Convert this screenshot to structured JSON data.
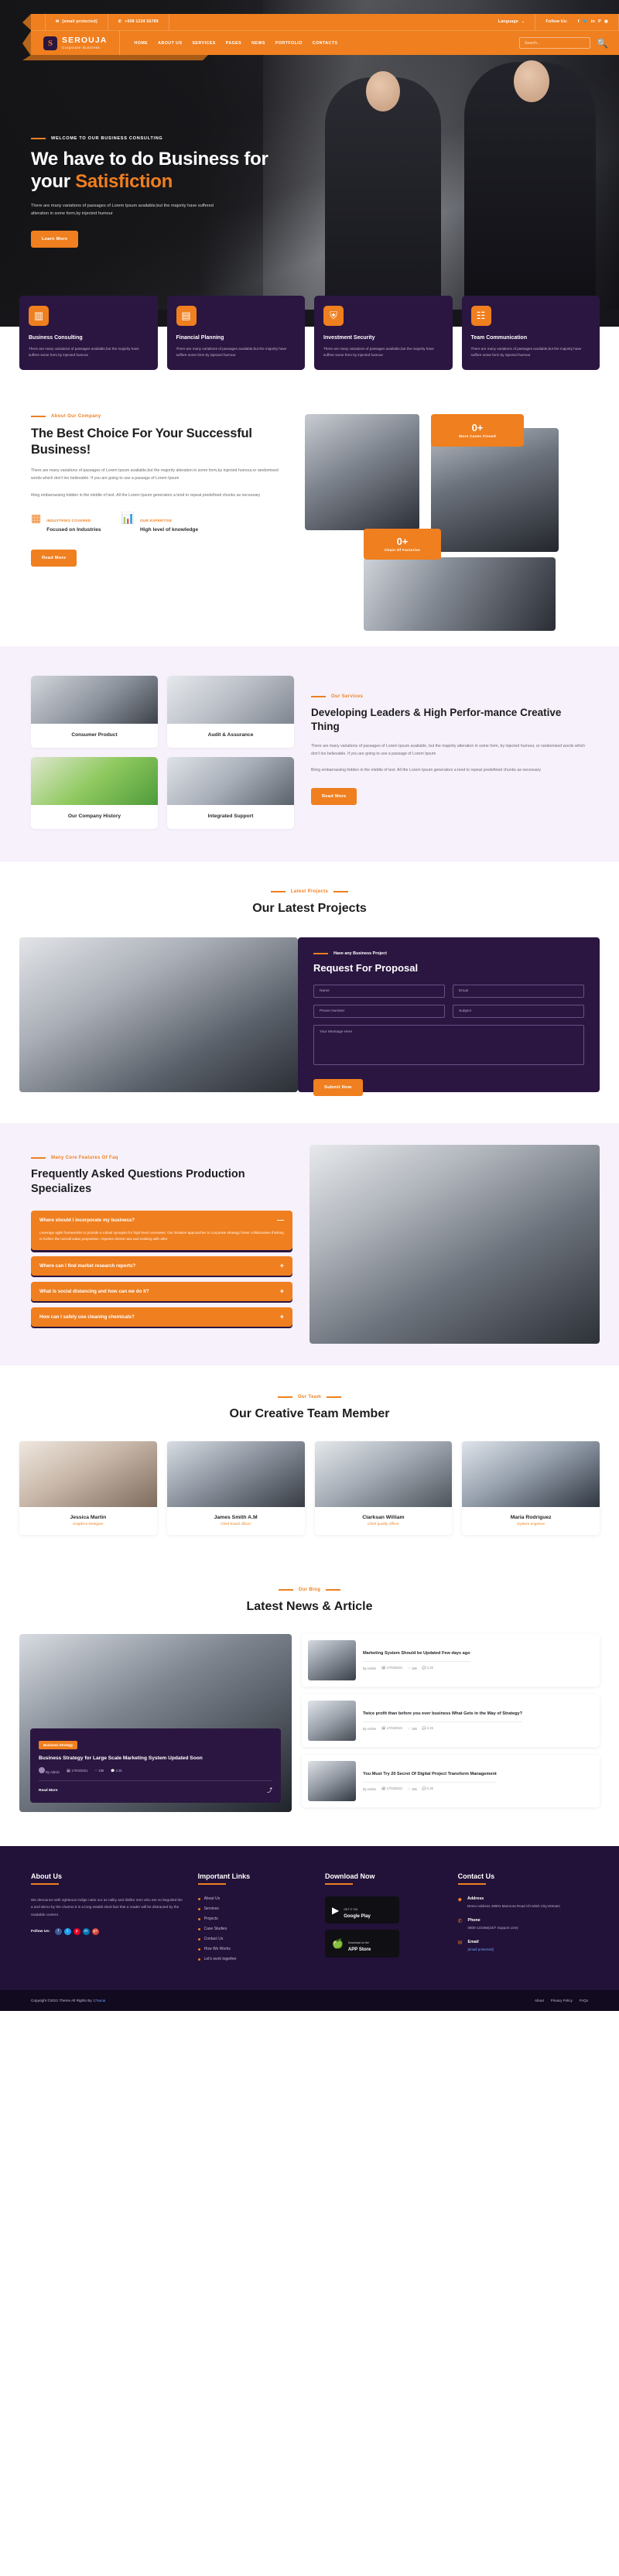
{
  "topbar": {
    "email": "[email protected]",
    "email_icon": "envelope-icon",
    "phone": "+008 1234 56789",
    "phone_icon": "phone-icon",
    "language": "Language",
    "follow_label": "Follow Us:",
    "socials": [
      "facebook-icon",
      "twitter-icon",
      "linkedin-icon",
      "pinterest-icon",
      "instagram-icon"
    ]
  },
  "nav": {
    "logo": "SEROUJA",
    "tagline": "Corporate Business",
    "links": [
      "HOME",
      "ABOUT US",
      "SERVICES",
      "PAGES",
      "NEWS",
      "PORTFOLIO",
      "CONTACTS"
    ],
    "search_placeholder": "Search...",
    "search_icon": "search-icon"
  },
  "hero": {
    "eyebrow": "WELCOME TO OUR BUSINESS CONSULTING",
    "title_line1": "We have to do Business for",
    "title_line2_plain": "your ",
    "title_line2_accent": "Satisfiction",
    "desc": "There are many variations of passages of Lorem Ipsum available,but the majority have suffered alteration in some form,by injected humour",
    "cta": "Learn More"
  },
  "service_cards": [
    {
      "icon": "chart-presentation-icon",
      "title": "Business Consulting",
      "desc": "There are many variations of passages available,but the majority have suffere some form by injected humour"
    },
    {
      "icon": "financial-plan-icon",
      "title": "Financial Planning",
      "desc": "There are many variations of passages available,but the majority have suffere some form by injected humour"
    },
    {
      "icon": "shield-lock-icon",
      "title": "Investment Security",
      "desc": "There are many variations of passages available,but the majority have suffere some form by injected humour"
    },
    {
      "icon": "team-chat-icon",
      "title": "Team Communication",
      "desc": "There are many variations of passages available,but the majority have suffere some form by injected humour"
    }
  ],
  "about": {
    "eyebrow": "About Our Company",
    "title": "The Best Choice For Your Successful Business!",
    "p1": "There are many variations of passages of Lorem Ipsum available,but the majority alteration in some form,by injected humour,or randomised words which don't loo believable. If you are going to use a passage of Lorem Ipsum",
    "p2": "thing embarrassing hidden in the middle of text. All the Lorem Ipsum generators a tend to repeat predefined chunks as necessary",
    "features": [
      {
        "icon": "industry-icon",
        "kicker": "INDUSTRIES COVERED",
        "value": "Focused on Industries"
      },
      {
        "icon": "expertise-chart-icon",
        "kicker": "OUR EXPERTISE",
        "value": "High level of knowledge"
      }
    ],
    "cta": "Read More",
    "badge_top": {
      "num": "0+",
      "label": "More Cases Closed"
    },
    "badge_bottom": {
      "num": "0+",
      "label": "Chain Of Factories"
    }
  },
  "services_section": {
    "eyebrow": "Our Services",
    "title": "Developing Leaders & High Perfor-mance Creative Thing",
    "desc": "There are many variations of passages of Lorem Ipsum available, but the majority alteration in some form, by injected humour, or randomised words which don't loo believable. If you are going to use a passage of Lorem Ipsum",
    "desc2": "Bring embarrassing hidden in the middle of text. All the Lorem Ipsum generators a tend to repeat predefined chunks as necessary",
    "cta": "Read More",
    "tiles": [
      {
        "image": "handshake-meeting-photo",
        "caption": "Consumer Product"
      },
      {
        "image": "woman-office-desk-photo",
        "caption": "Audit & Assurance"
      },
      {
        "image": "presentation-chart-photo",
        "caption": "Our Company History"
      },
      {
        "image": "call-center-photo",
        "caption": "Integrated Support"
      }
    ]
  },
  "projects": {
    "eyebrow": "Latest Projects",
    "title": "Our Latest Projects",
    "image": "business-couple-photo"
  },
  "rfp": {
    "eyebrow": "Have any Business Project",
    "title": "Request For Proposal",
    "fields": {
      "name": "Name",
      "email": "Email",
      "phone": "Phone Number",
      "subject": "Subject",
      "message": "Your Message Here"
    },
    "submit": "Submit Now"
  },
  "faq": {
    "eyebrow": "Many Core Features Of Faq",
    "title": "Frequently Asked Questions Production Specializes",
    "items": [
      {
        "q": "Where should I incorporate my business?",
        "a": "Leverage agile frameworks to provide a robust synopsis for high level overviews. Our iterative approaches to corporate strategy foster collaborative thinking to further the overall value proposition. Impress clients new and existing with after",
        "open": true,
        "sign": "—"
      },
      {
        "q": "Where can I find market research reports?",
        "open": false,
        "sign": "+"
      },
      {
        "q": "What is social distancing and how can we do it?",
        "open": false,
        "sign": "+"
      },
      {
        "q": "How can I safely use cleaning chemicals?",
        "open": false,
        "sign": "+"
      }
    ],
    "image": "team-tablet-photo"
  },
  "team": {
    "eyebrow": "Our Team",
    "title": "Our Creative Team Member",
    "members": [
      {
        "photo": "woman-portrait-photo",
        "name": "Jessica Martin",
        "role": "Graphics Designer"
      },
      {
        "photo": "man-portrait-photo",
        "name": "James Smith A.M",
        "role": "Chief board officer"
      },
      {
        "photo": "man-glasses-portrait-photo",
        "name": "Clarksan William",
        "role": "Chief quality officer"
      },
      {
        "photo": "bearded-man-portrait-photo",
        "name": "Maria Rodriguez",
        "role": "System engineer"
      }
    ]
  },
  "blog": {
    "eyebrow": "Our Blog",
    "title": "Latest News & Article",
    "featured": {
      "image": "office-team-photo",
      "badge": "Business Strategy",
      "title": "Business Strategy for Large Scale Marketing System Updated Soon",
      "author": "By Admin",
      "date": "17/04/2021",
      "likes": "196",
      "comments": "2.2k",
      "read_more": "Read More",
      "share_icon": "share-icon"
    },
    "posts": [
      {
        "thumb": "meeting-photo",
        "title": "Marketing System Should be Updated Few days ago",
        "author": "By Admin",
        "date": "17/04/2021",
        "likes": "196",
        "comments": "2.2k"
      },
      {
        "thumb": "laptop-work-photo",
        "title": "Twice profit than before you ever business What Gets in the Way of Strategy?",
        "author": "By Admin",
        "date": "17/04/2021",
        "likes": "196",
        "comments": "2.2k"
      },
      {
        "thumb": "handshake-photo",
        "title": "You Must Try 20 Secret Of Digital Project Transform Management",
        "author": "By Admin",
        "date": "17/04/2021",
        "likes": "196",
        "comments": "2.2k"
      }
    ]
  },
  "footer": {
    "about": {
      "heading": "About Us",
      "text": "We denounce with righteous indige natio our as nality and dislike men who are so beguiled the a and demo by the charms.It is a long establi shed fact that a reader will be distracted by the readable content",
      "follow_label": "Follow Us:",
      "socials": [
        {
          "name": "facebook-icon",
          "glyph": "f",
          "color": "#3b5998"
        },
        {
          "name": "twitter-icon",
          "glyph": "t",
          "color": "#1da1f2"
        },
        {
          "name": "pinterest-icon",
          "glyph": "p",
          "color": "#e60023"
        },
        {
          "name": "linkedin-icon",
          "glyph": "in",
          "color": "#0077b5"
        },
        {
          "name": "googleplus-icon",
          "glyph": "g+",
          "color": "#db4437"
        }
      ]
    },
    "links": {
      "heading": "Important Links",
      "items": [
        "About Us",
        "Services",
        "Projects",
        "Case Studies",
        "Contact Us",
        "How We Works",
        "Let's work together"
      ]
    },
    "download": {
      "heading": "Download Now",
      "google": {
        "icon": "google-play-icon",
        "t1": "GET IT ON",
        "t2": "Google Play"
      },
      "apple": {
        "icon": "apple-icon",
        "t1": "Download on the",
        "t2": "APP Store"
      }
    },
    "contact": {
      "heading": "Contact Us",
      "items": [
        {
          "icon": "location-pin-icon",
          "key": "Address",
          "value": "Demo Address 48901 Marmora Road Chi Minh City,Vietnam"
        },
        {
          "icon": "phone-icon",
          "key": "Phone",
          "value": "0800-123456(24/7 Support Line)"
        },
        {
          "icon": "envelope-icon",
          "key": "Email",
          "value": "[email protected]",
          "is_link": true
        }
      ]
    }
  },
  "copyright": {
    "text": "Copyright ©2021 Theme All Rights By ",
    "link": "17sucai",
    "links": [
      "About",
      "Privacy Policy",
      "FAQs"
    ]
  }
}
